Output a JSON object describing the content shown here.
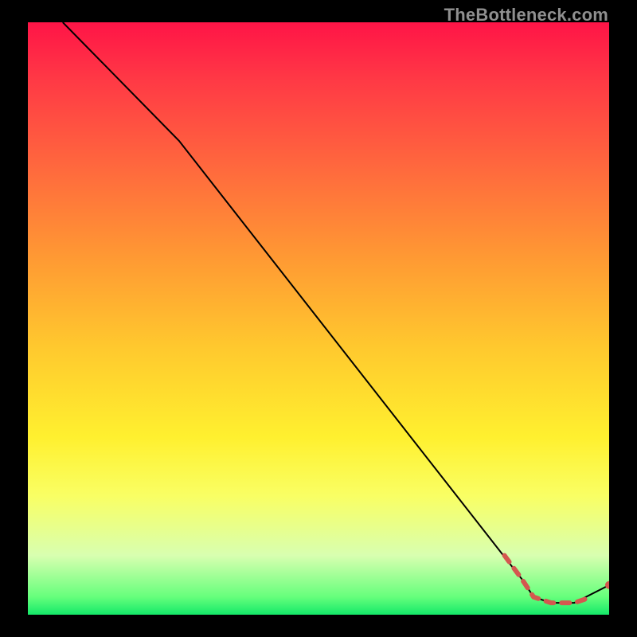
{
  "watermark": "TheBottleneck.com",
  "chart_data": {
    "type": "line",
    "title": "",
    "xlabel": "",
    "ylabel": "",
    "xlim": [
      0,
      100
    ],
    "ylim": [
      0,
      100
    ],
    "series": [
      {
        "name": "line",
        "style": "solid-black",
        "points": [
          {
            "x": 6,
            "y": 100
          },
          {
            "x": 26,
            "y": 80
          },
          {
            "x": 85,
            "y": 6
          },
          {
            "x": 87,
            "y": 3
          },
          {
            "x": 90,
            "y": 2
          },
          {
            "x": 94,
            "y": 2
          },
          {
            "x": 100,
            "y": 5
          }
        ]
      },
      {
        "name": "dashed-highlight",
        "style": "dashed-red",
        "points": [
          {
            "x": 82,
            "y": 10
          },
          {
            "x": 85,
            "y": 6
          },
          {
            "x": 87,
            "y": 3
          },
          {
            "x": 90,
            "y": 2
          },
          {
            "x": 94,
            "y": 2
          },
          {
            "x": 97,
            "y": 3
          }
        ]
      }
    ],
    "markers": [
      {
        "x": 100,
        "y": 5,
        "color": "#d4574f"
      }
    ],
    "colors": {
      "line": "#000000",
      "highlight": "#d4574f"
    }
  }
}
